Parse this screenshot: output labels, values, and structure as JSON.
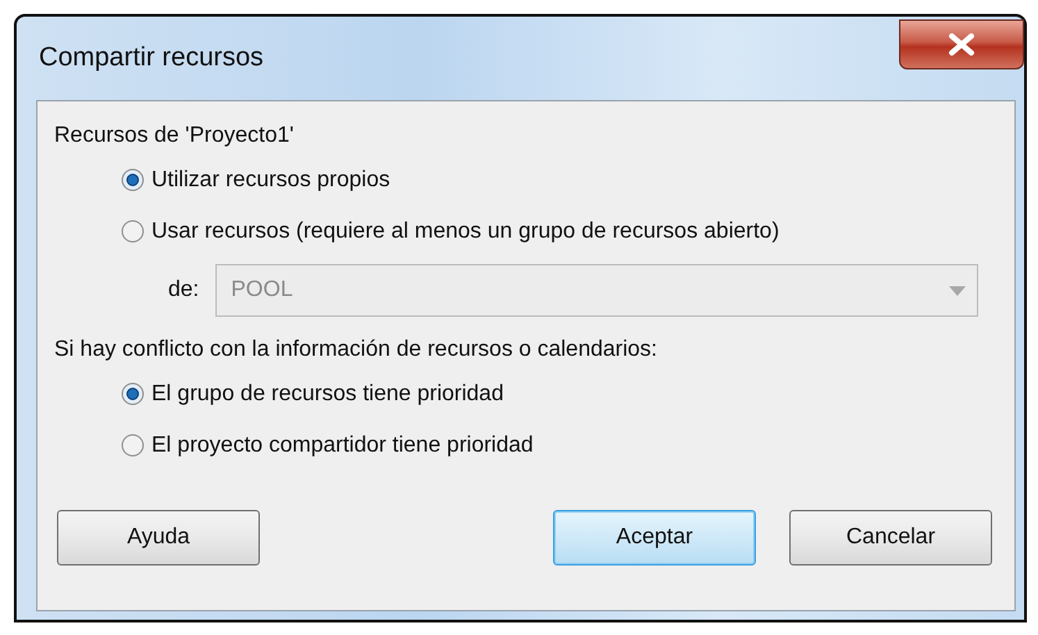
{
  "window": {
    "title": "Compartir recursos"
  },
  "resources": {
    "label": "Recursos de 'Proyecto1'",
    "options": [
      {
        "label": "Utilizar recursos propios",
        "selected": true
      },
      {
        "label": "Usar recursos (requiere al menos un grupo de recursos abierto)",
        "selected": false
      }
    ],
    "pool": {
      "label": "de:",
      "value": "POOL",
      "disabled": true
    }
  },
  "conflict": {
    "label": "Si hay conflicto con la información de recursos o calendarios:",
    "options": [
      {
        "label": "El grupo de recursos tiene prioridad",
        "selected": true
      },
      {
        "label": "El proyecto compartidor tiene prioridad",
        "selected": false
      }
    ]
  },
  "buttons": [
    {
      "label": "Ayuda",
      "default": false
    },
    {
      "label": "Aceptar",
      "default": true
    },
    {
      "label": "Cancelar",
      "default": false
    }
  ]
}
